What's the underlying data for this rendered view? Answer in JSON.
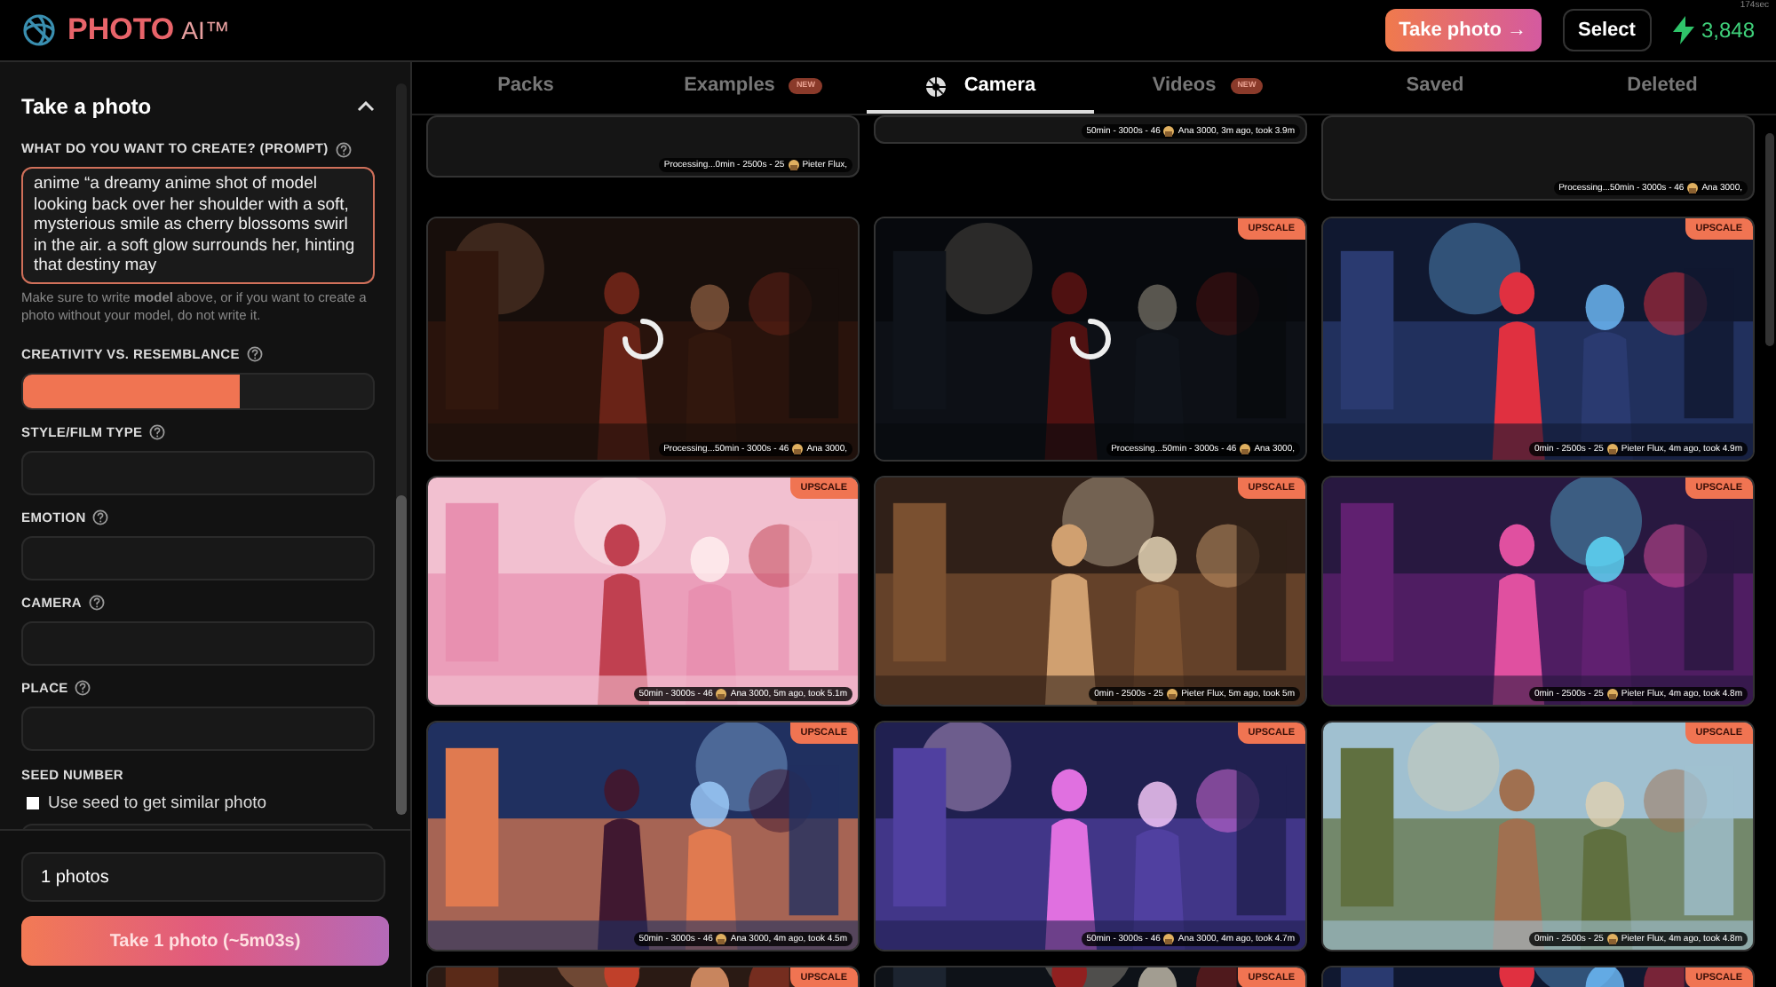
{
  "header": {
    "logo_main": "PHOTO",
    "logo_suffix": "AI™",
    "take_photo_button": "Take photo →",
    "select_button": "Select",
    "credits": "3,848",
    "timer": "174sec"
  },
  "sidebar": {
    "title": "Take a photo",
    "expanded": true,
    "prompt": {
      "label": "WHAT DO YOU WANT TO CREATE? (PROMPT)",
      "value": "anime “a dreamy anime shot of model looking back over her shoulder with a soft, mysterious smile as cherry blossoms swirl in the air. a soft glow surrounds her, hinting that destiny may",
      "hint": "Make sure to write **model** above, or if you want to create a photo without your model, do not write it."
    },
    "fields": [
      {
        "kind": "slider",
        "label": "CREATIVITY VS. RESEMBLANCE",
        "level": 0.62
      },
      {
        "kind": "text",
        "label": "STYLE/FILM TYPE"
      },
      {
        "kind": "text",
        "label": "EMOTION"
      },
      {
        "kind": "text",
        "label": "CAMERA"
      },
      {
        "kind": "text",
        "label": "PLACE"
      },
      {
        "kind": "seed",
        "label": "SEED NUMBER",
        "checkbox_label": "Use seed to get similar photo",
        "checked": false
      }
    ],
    "count": "1 photos",
    "submit": "Take 1 photo (~5m03s)"
  },
  "tabs": [
    {
      "kind": "plain",
      "label": "Packs",
      "selected": false
    },
    {
      "kind": "badge",
      "label": "Examples",
      "badge": "NEW",
      "selected": false
    },
    {
      "kind": "icon",
      "label": "Camera",
      "selected": true
    },
    {
      "kind": "badge",
      "label": "Videos",
      "badge": "NEW",
      "selected": false
    },
    {
      "kind": "plain",
      "label": "Saved",
      "selected": false
    },
    {
      "kind": "plain",
      "label": "Deleted",
      "selected": false
    }
  ],
  "grid": [
    [
      {
        "stats": "Processing...0min - 2500s - 25",
        "user": "Pieter Flux,"
      },
      {
        "stats": "50min - 3000s - 46",
        "user": "Ana 3000, 3m ago, took 3.9m"
      },
      {
        "stats": "Processing...50min - 3000s - 46",
        "user": "Ana 3000,"
      }
    ],
    [
      {
        "processing": true,
        "stats": "Processing...50min - 3000s - 46",
        "user": "Ana 3000,"
      },
      {
        "processing": true,
        "badge": "UPSCALE",
        "stats": "Processing...50min - 3000s - 46",
        "user": "Ana 3000,"
      },
      {
        "processing": false,
        "badge": "UPSCALE",
        "stats": "0min - 2500s - 25",
        "user": "Pieter Flux, 4m ago, took 4.9m"
      }
    ],
    [
      {
        "processing": false,
        "badge": "UPSCALE",
        "stats": "50min - 3000s - 46",
        "user": "Ana 3000, 5m ago, took 5.1m"
      },
      {
        "processing": false,
        "badge": "UPSCALE",
        "stats": "0min - 2500s - 25",
        "user": "Pieter Flux, 5m ago, took 5m"
      },
      {
        "processing": false,
        "badge": "UPSCALE",
        "stats": "0min - 2500s - 25",
        "user": "Pieter Flux, 4m ago, took 4.8m"
      }
    ],
    [
      {
        "processing": false,
        "badge": "UPSCALE",
        "stats": "50min - 3000s - 46",
        "user": "Ana 3000, 4m ago, took 4.5m"
      },
      {
        "processing": false,
        "badge": "UPSCALE",
        "stats": "50min - 3000s - 46",
        "user": "Ana 3000, 4m ago, took 4.7m"
      },
      {
        "processing": false,
        "badge": "UPSCALE",
        "stats": "0min - 2500s - 25",
        "user": "Pieter Flux, 4m ago, took 4.8m"
      }
    ],
    [
      {
        "processing": false,
        "badge": "UPSCALE"
      },
      {
        "processing": false,
        "badge": "UPSCALE"
      },
      {
        "processing": false,
        "badge": "UPSCALE"
      }
    ]
  ]
}
